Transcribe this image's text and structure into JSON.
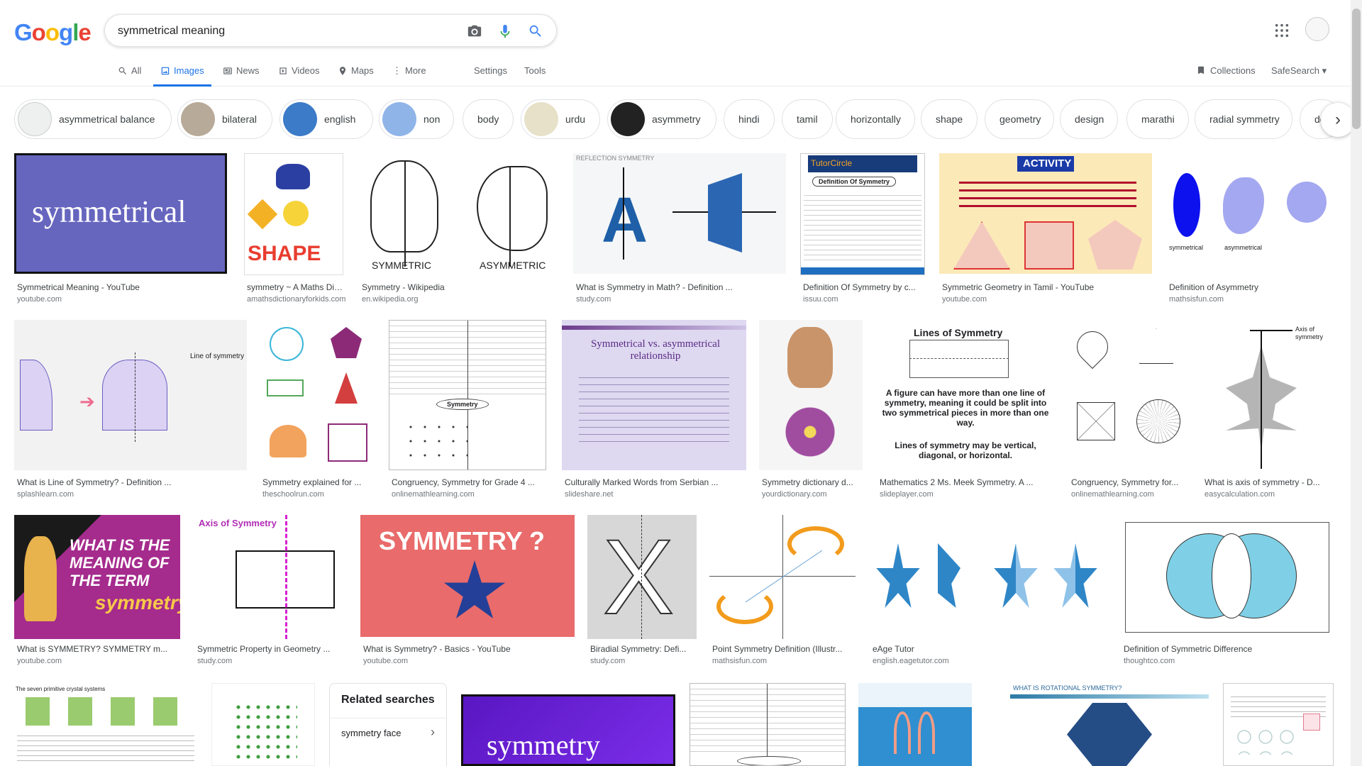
{
  "search": {
    "query": "symmetrical meaning"
  },
  "tabs": [
    {
      "label": "All",
      "icon": "search-icon"
    },
    {
      "label": "Images",
      "icon": "image-icon"
    },
    {
      "label": "News",
      "icon": "news-icon"
    },
    {
      "label": "Videos",
      "icon": "video-icon"
    },
    {
      "label": "Maps",
      "icon": "map-icon"
    },
    {
      "label": "More",
      "icon": "more-icon"
    }
  ],
  "tools": {
    "settings": "Settings",
    "tools": "Tools",
    "collections": "Collections",
    "safesearch": "SafeSearch"
  },
  "chips": [
    "asymmetrical balance",
    "bilateral",
    "english",
    "non",
    "body",
    "urdu",
    "asymmetry",
    "hindi",
    "tamil",
    "horizontally",
    "shape",
    "geometry",
    "design",
    "marathi",
    "radial symmetry",
    "de"
  ],
  "results": [
    {
      "title": "Symmetrical Meaning - YouTube",
      "source": "youtube.com",
      "imgtext": "symmetrical"
    },
    {
      "title": "symmetry ~ A Maths Dictionary for Kids",
      "source": "amathsdictionaryforkids.com",
      "imgtext": "SHAPE"
    },
    {
      "title": "Symmetry - Wikipedia",
      "source": "en.wikipedia.org",
      "imgtext": "SYMMETRIC",
      "imgtext2": "ASYMMETRIC"
    },
    {
      "title": "What is Symmetry in Math? - Definition ...",
      "source": "study.com",
      "imgtext": "REFLECTION SYMMETRY"
    },
    {
      "title": "Definition Of Symmetry by c...",
      "source": "issuu.com",
      "imgtext": "TutorCircle",
      "imgtext2": "Definition Of Symmetry"
    },
    {
      "title": "Symmetric Geometry in Tamil - YouTube",
      "source": "youtube.com",
      "imgtext": "ACTIVITY"
    },
    {
      "title": "Definition of Asymmetry",
      "source": "mathsisfun.com",
      "imgtext": "symmetrical",
      "imgtext2": "asymmetrical"
    },
    {
      "title": "What is Line of Symmetry? - Definition ...",
      "source": "splashlearn.com",
      "imgtext": "Line of symmetry"
    },
    {
      "title": "Symmetry explained for ...",
      "source": "theschoolrun.com"
    },
    {
      "title": "Congruency, Symmetry for Grade 4 ...",
      "source": "onlinemathlearning.com",
      "imgtext": "Symmetry"
    },
    {
      "title": "Culturally Marked Words from Serbian ...",
      "source": "slideshare.net",
      "imgtext": "Symmetrical vs. asymmetrical relationship"
    },
    {
      "title": "Symmetry dictionary d...",
      "source": "yourdictionary.com"
    },
    {
      "title": "Mathematics 2 Ms. Meek Symmetry. A ...",
      "source": "slideplayer.com",
      "imgtext": "Lines of Symmetry",
      "imgtext2": "A figure can have more than one line of symmetry, meaning it could be split into two symmetrical pieces in more than one way.",
      "imgtext3": "Lines of symmetry may be vertical, diagonal, or horizontal."
    },
    {
      "title": "Congruency, Symmetry for...",
      "source": "onlinemathlearning.com"
    },
    {
      "title": "What is axis of symmetry - D...",
      "source": "easycalculation.com",
      "imgtext": "Axis of symmetry"
    },
    {
      "title": "What is SYMMETRY? SYMMETRY m...",
      "source": "youtube.com",
      "imgtext": "WHAT IS THE MEANING OF THE TERM",
      "imgtext2": "symmetry"
    },
    {
      "title": "Symmetric Property in Geometry ...",
      "source": "study.com",
      "imgtext": "Axis of Symmetry"
    },
    {
      "title": "What is Symmetry? - Basics - YouTube",
      "source": "youtube.com",
      "imgtext": "SYMMETRY ?"
    },
    {
      "title": "Biradial Symmetry: Defi...",
      "source": "study.com"
    },
    {
      "title": "Point Symmetry Definition (Illustr...",
      "source": "mathsisfun.com"
    },
    {
      "title": "eAge Tutor",
      "source": "english.eagetutor.com"
    },
    {
      "title": "Definition of Symmetric Difference",
      "source": "thoughtco.com"
    }
  ],
  "related": {
    "heading": "Related searches",
    "item": "symmetry face"
  },
  "bottom": {
    "imgtext": "symmetry",
    "imgtext2": "The seven primitive crystal systems",
    "imgtext3": "WHAT IS ROTATIONAL SYMMETRY?"
  },
  "colors": {
    "accent": "#1a73e8",
    "muted": "#70757a"
  }
}
